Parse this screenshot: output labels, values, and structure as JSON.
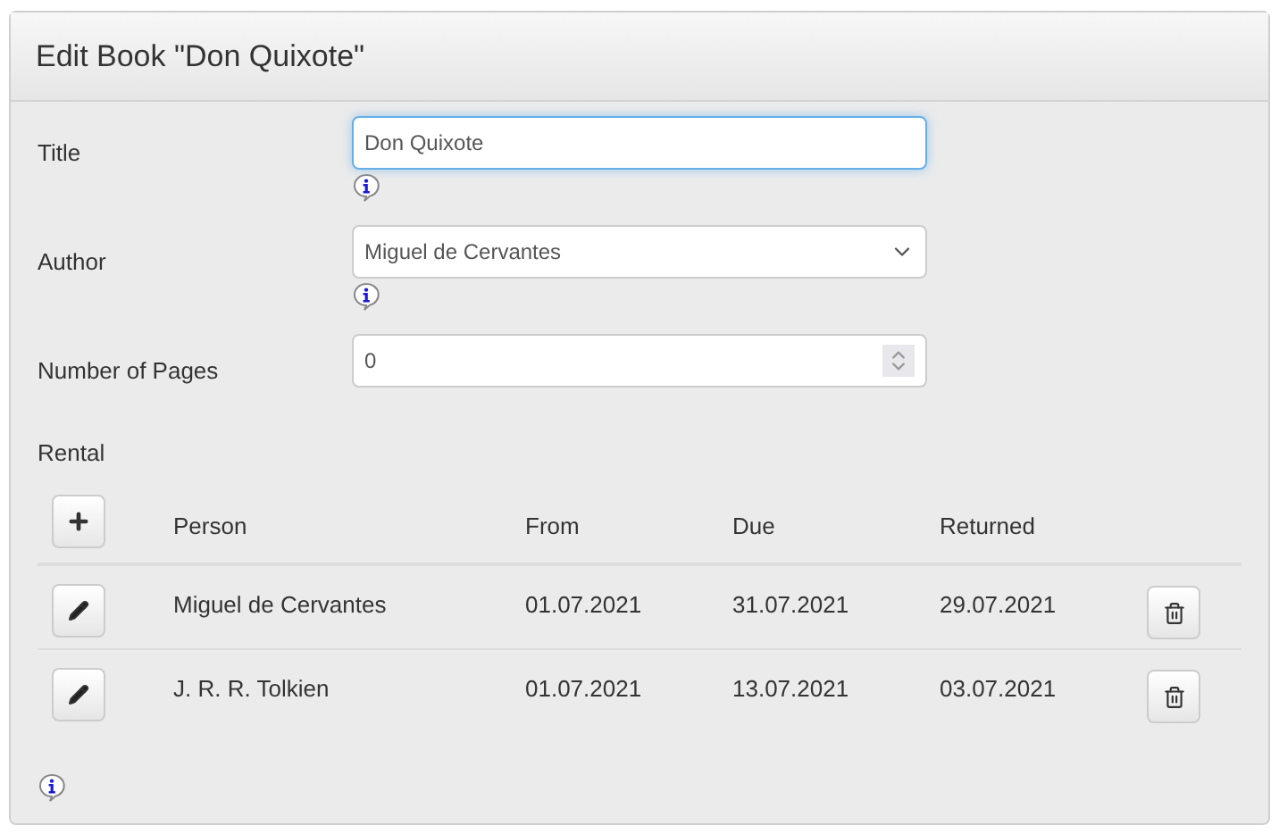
{
  "dialog": {
    "title": "Edit Book \"Don Quixote\""
  },
  "fields": [
    {
      "kind": "text",
      "label": "Title",
      "value": "Don Quixote",
      "focused": true,
      "info": true
    },
    {
      "kind": "select",
      "label": "Author",
      "value": "Miguel de Cervantes",
      "focused": false,
      "info": true
    },
    {
      "kind": "number",
      "label": "Number of Pages",
      "value": "0",
      "focused": false,
      "info": false
    }
  ],
  "rental": {
    "label": "Rental",
    "columns": [
      "Person",
      "From",
      "Due",
      "Returned"
    ],
    "rows": [
      {
        "cells": [
          "Miguel de Cervantes",
          "01.07.2021",
          "31.07.2021",
          "29.07.2021"
        ]
      },
      {
        "cells": [
          "J. R. R. Tolkien",
          "01.07.2021",
          "13.07.2021",
          "03.07.2021"
        ]
      }
    ],
    "info": true
  }
}
